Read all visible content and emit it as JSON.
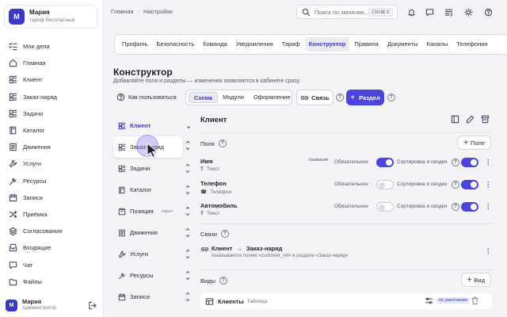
{
  "sidebar": {
    "org": {
      "initial": "М",
      "name": "Мария",
      "plan": "тариф бесплатный"
    },
    "items": [
      {
        "label": "Мои дела",
        "icon": "checklist-icon"
      },
      {
        "label": "Главная",
        "icon": "home-icon"
      },
      {
        "label": "Клиент",
        "icon": "grid-icon"
      },
      {
        "label": "Заказ-наряд",
        "icon": "grid-icon"
      },
      {
        "label": "Задачи",
        "icon": "grid-icon"
      },
      {
        "label": "Каталог",
        "icon": "book-icon"
      },
      {
        "label": "Движения",
        "icon": "list-icon"
      },
      {
        "label": "Услуги",
        "icon": "wrench-icon"
      },
      {
        "label": "Ресурсы",
        "icon": "tool-icon"
      },
      {
        "label": "Записи",
        "icon": "calendar-icon"
      },
      {
        "label": "Приёмка",
        "icon": "shuffle-icon"
      },
      {
        "label": "Согласования",
        "icon": "stack-icon"
      },
      {
        "label": "Входящие",
        "icon": "inbox-icon"
      },
      {
        "label": "Чат",
        "icon": "chat-icon"
      },
      {
        "label": "Файлы",
        "icon": "folder-icon"
      }
    ],
    "user": {
      "initial": "М",
      "name": "Мария",
      "role": "Администратор"
    }
  },
  "topbar": {
    "breadcrumb": [
      "Главная",
      "Настройки"
    ],
    "search_placeholder": "Поиск по записям...",
    "search_shortcut": "Ctrl/⌘ K"
  },
  "tabs": [
    "Профиль",
    "Безопасность",
    "Команда",
    "Уведомления",
    "Тариф",
    "Конструктор",
    "Правила",
    "Документы",
    "Каналы",
    "Телефония"
  ],
  "active_tab": "Конструктор",
  "header": {
    "title": "Конструктор",
    "subtitle": "Добавляйте поля и разделы — изменения появляются в кабинете сразу.",
    "howto": "Как пользоваться",
    "segments": [
      "Схема",
      "Модули",
      "Оформление"
    ],
    "active_segment": "Схема",
    "link_button": "Связь",
    "section_button": "Раздел",
    "help": "?"
  },
  "sections": [
    {
      "label": "Клиент",
      "active": true,
      "tag": ""
    },
    {
      "label": "Заказ-наряд",
      "active": false,
      "tag": ""
    },
    {
      "label": "Задачи",
      "active": false,
      "tag": ""
    },
    {
      "label": "Каталог",
      "active": false,
      "tag": ""
    },
    {
      "label": "Позиция",
      "active": false,
      "tag": "скрыт"
    },
    {
      "label": "Движения",
      "active": false,
      "tag": ""
    },
    {
      "label": "Услуги",
      "active": false,
      "tag": ""
    },
    {
      "label": "Ресурсы",
      "active": false,
      "tag": ""
    },
    {
      "label": "Записи",
      "active": false,
      "tag": ""
    }
  ],
  "panel": {
    "title": "Клиент",
    "fields_label": "Поля",
    "add_field": "Поле",
    "required_label": "Обязательное",
    "sort_label": "Сортировка и сводки",
    "fields": [
      {
        "name": "Имя",
        "type": "Текст",
        "badge": "Название",
        "required": true,
        "sort": true
      },
      {
        "name": "Телефон",
        "type": "Телефон",
        "badge": "",
        "required": false,
        "sort": true
      },
      {
        "name": "Автомобиль",
        "type": "Текст",
        "badge": "",
        "required": false,
        "sort": true
      }
    ],
    "links_label": "Связи",
    "link": {
      "from": "Клиент",
      "to": "Заказ-наряд",
      "desc": "показывается полем «customer_ref» в разделе «Заказ-наряд»"
    },
    "views_label": "Виды",
    "add_view": "Вид",
    "views": [
      {
        "name": "Клиенты",
        "type": "Таблица",
        "badge": "по умолчанию"
      }
    ]
  },
  "colors": {
    "accent": "#4b45d9",
    "brand": "#3a37c9"
  }
}
